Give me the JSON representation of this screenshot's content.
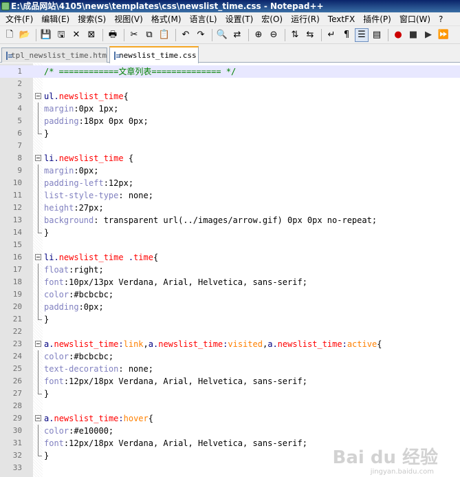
{
  "window": {
    "title": "E:\\成品网站\\4105\\news\\templates\\css\\newslist_time.css - Notepad++"
  },
  "menu": [
    "文件(F)",
    "编辑(E)",
    "搜索(S)",
    "视图(V)",
    "格式(M)",
    "语言(L)",
    "设置(T)",
    "宏(O)",
    "运行(R)",
    "TextFX",
    "插件(P)",
    "窗口(W)",
    "?"
  ],
  "toolbar": {
    "buttons": [
      "new-file-icon",
      "open-file-icon",
      "save-icon",
      "save-all-icon",
      "close-icon",
      "close-all-icon",
      "print-icon",
      "cut-icon",
      "copy-icon",
      "paste-icon",
      "undo-icon",
      "redo-icon",
      "find-icon",
      "replace-icon",
      "zoom-in-icon",
      "zoom-out-icon",
      "sync-v-icon",
      "sync-h-icon",
      "wrap-icon",
      "show-all-chars-icon",
      "indent-guide-icon",
      "doc-map-icon",
      "record-macro-icon",
      "stop-macro-icon",
      "play-macro-icon",
      "run-macro-icon"
    ]
  },
  "tabs": [
    {
      "label": "tpl_newslist_time.htm",
      "active": false
    },
    {
      "label": "newslist_time.css",
      "active": true
    }
  ],
  "editor": {
    "lines": [
      {
        "n": "1",
        "text": "/* ============文章列表============== */"
      },
      {
        "n": "2",
        "text": ""
      },
      {
        "n": "3",
        "text": "ul.newslist_time{"
      },
      {
        "n": "4",
        "text": "margin:0px 1px;"
      },
      {
        "n": "5",
        "text": "padding:18px 0px 0px;"
      },
      {
        "n": "6",
        "text": "}"
      },
      {
        "n": "7",
        "text": ""
      },
      {
        "n": "8",
        "text": "li.newslist_time {"
      },
      {
        "n": "9",
        "text": "margin:0px;"
      },
      {
        "n": "10",
        "text": "padding-left:12px;"
      },
      {
        "n": "11",
        "text": "list-style-type: none;"
      },
      {
        "n": "12",
        "text": "height:27px;"
      },
      {
        "n": "13",
        "text": "background: transparent url(../images/arrow.gif) 0px 0px no-repeat;"
      },
      {
        "n": "14",
        "text": "}"
      },
      {
        "n": "15",
        "text": ""
      },
      {
        "n": "16",
        "text": "li.newslist_time .time{"
      },
      {
        "n": "17",
        "text": "float:right;"
      },
      {
        "n": "18",
        "text": "font:10px/13px Verdana, Arial, Helvetica, sans-serif;"
      },
      {
        "n": "19",
        "text": "color:#bcbcbc;"
      },
      {
        "n": "20",
        "text": "padding:0px;"
      },
      {
        "n": "21",
        "text": "}"
      },
      {
        "n": "22",
        "text": ""
      },
      {
        "n": "23",
        "text": "a.newslist_time:link,a.newslist_time:visited,a.newslist_time:active{"
      },
      {
        "n": "24",
        "text": "color:#bcbcbc;"
      },
      {
        "n": "25",
        "text": "text-decoration: none;"
      },
      {
        "n": "26",
        "text": "font:12px/18px Verdana, Arial, Helvetica, sans-serif;"
      },
      {
        "n": "27",
        "text": "}"
      },
      {
        "n": "28",
        "text": ""
      },
      {
        "n": "29",
        "text": "a.newslist_time:hover{"
      },
      {
        "n": "30",
        "text": "color:#e10000;"
      },
      {
        "n": "31",
        "text": "font:12px/18px Verdana, Arial, Helvetica, sans-serif;"
      },
      {
        "n": "32",
        "text": "}"
      },
      {
        "n": "33",
        "text": ""
      }
    ]
  },
  "watermark": {
    "main": "Bai du 经验",
    "sub": "jingyan.baidu.com"
  },
  "colors": {
    "comment": "#008000",
    "selector_class": "#ff0000",
    "property": "#8080c0",
    "pseudo": "#ff8000",
    "current_line": "#e8e8ff"
  }
}
